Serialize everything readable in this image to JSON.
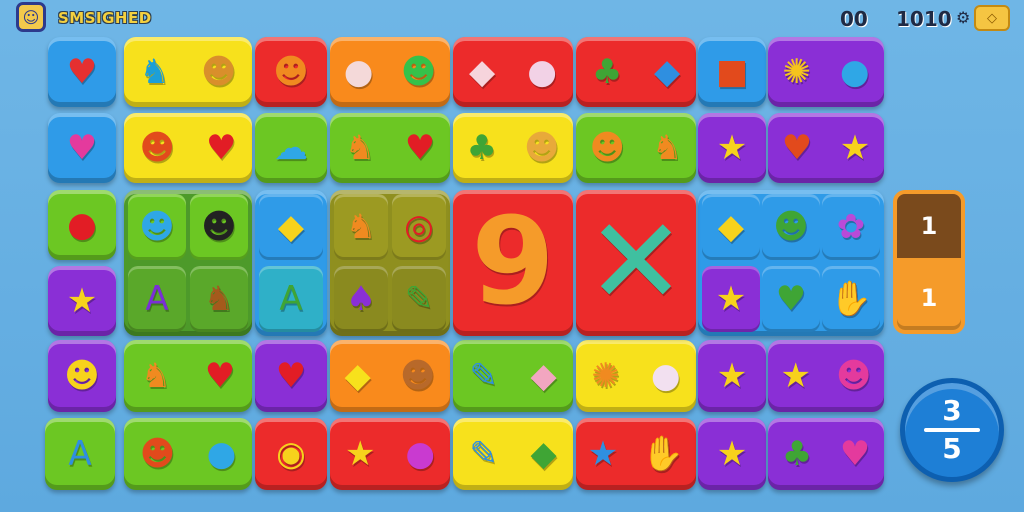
{
  "hud": {
    "title": "SMSIGHED",
    "avatar_icon": "robot-face-icon",
    "avatar_glyph": "☺",
    "counter_left": "00",
    "counter_right": "1010",
    "gear_icon": "gear-icon",
    "gear_glyph": "⚙",
    "coin_icon": "coin-icon",
    "coin_glyph": "◇"
  },
  "colors": {
    "blue": "#2f9be8",
    "yellow": "#f7e11c",
    "red": "#ec2b2b",
    "orange": "#f98a1c",
    "green": "#6cc723",
    "purple": "#8a2fd6",
    "olive": "#8f8f1f"
  },
  "tiles": [
    {
      "name": "tile-strawberry",
      "color": "blue",
      "icons": [
        {
          "name": "strawberry-icon",
          "glyph": "♥",
          "tint": "#e53030"
        }
      ]
    },
    {
      "name": "tile-animals",
      "color": "yellow",
      "icons": [
        {
          "name": "llama-icon",
          "glyph": "♞",
          "tint": "#1c9fd8"
        },
        {
          "name": "lion-face-icon",
          "glyph": "☻",
          "tint": "#d98f2b"
        }
      ]
    },
    {
      "name": "tile-lion",
      "color": "red",
      "icons": [
        {
          "name": "lion-face-icon",
          "glyph": "☻",
          "tint": "#f08a20"
        }
      ]
    },
    {
      "name": "tile-mouse-cat",
      "color": "orange",
      "icons": [
        {
          "name": "mouse-icon",
          "glyph": "●",
          "tint": "#f4d9d9"
        },
        {
          "name": "cat-face-icon",
          "glyph": "☻",
          "tint": "#35c24a"
        }
      ]
    },
    {
      "name": "tile-fish-bunny",
      "color": "red",
      "icons": [
        {
          "name": "fish-icon",
          "glyph": "◆",
          "tint": "#f6d4dc"
        },
        {
          "name": "bunny-icon",
          "glyph": "●",
          "tint": "#f2d2e6"
        }
      ]
    },
    {
      "name": "tile-leaf-feather",
      "color": "red",
      "icons": [
        {
          "name": "leaf-icon",
          "glyph": "♣",
          "tint": "#3fa535"
        },
        {
          "name": "feather-icon",
          "glyph": "◆",
          "tint": "#2f8fe0"
        }
      ]
    },
    {
      "name": "tile-box",
      "color": "blue",
      "icons": [
        {
          "name": "box-icon",
          "glyph": "■",
          "tint": "#e24a1c"
        }
      ]
    },
    {
      "name": "tile-sun-drop",
      "color": "purple",
      "icons": [
        {
          "name": "sun-icon",
          "glyph": "✺",
          "tint": "#f5c41d"
        },
        {
          "name": "droplet-icon",
          "glyph": "●",
          "tint": "#2fa7e6"
        }
      ]
    },
    {
      "name": "tile-chili",
      "color": "blue",
      "icons": [
        {
          "name": "chili-icon",
          "glyph": "♥",
          "tint": "#e43a9d"
        }
      ]
    },
    {
      "name": "tile-lion-heart",
      "color": "yellow",
      "icons": [
        {
          "name": "lion-face-icon",
          "glyph": "☻",
          "tint": "#e24a1c"
        },
        {
          "name": "heart-icon",
          "glyph": "♥",
          "tint": "#e21d25"
        }
      ]
    },
    {
      "name": "tile-cloud",
      "color": "green",
      "icons": [
        {
          "name": "cloud-icon",
          "glyph": "☁",
          "tint": "#2fa7e6"
        }
      ]
    },
    {
      "name": "tile-squirrel-heart",
      "color": "green",
      "icons": [
        {
          "name": "squirrel-icon",
          "glyph": "♞",
          "tint": "#f08a20"
        },
        {
          "name": "heart-icon",
          "glyph": "♥",
          "tint": "#e21d25"
        }
      ]
    },
    {
      "name": "tile-plant-cat",
      "color": "yellow",
      "icons": [
        {
          "name": "plant-icon",
          "glyph": "♣",
          "tint": "#3fa535"
        },
        {
          "name": "cat-face-icon",
          "glyph": "☻",
          "tint": "#e8a93a"
        }
      ]
    },
    {
      "name": "tile-lion-fox",
      "color": "green",
      "icons": [
        {
          "name": "lion-face-icon",
          "glyph": "☻",
          "tint": "#f08a20"
        },
        {
          "name": "fox-icon",
          "glyph": "♞",
          "tint": "#f08a20"
        }
      ]
    },
    {
      "name": "tile-star-purple-1",
      "color": "purple",
      "icons": [
        {
          "name": "star-icon",
          "glyph": "★",
          "tint": "#f7d21c"
        }
      ]
    },
    {
      "name": "tile-carrot-star",
      "color": "purple",
      "icons": [
        {
          "name": "carrot-icon",
          "glyph": "♥",
          "tint": "#e24a1c"
        },
        {
          "name": "star-icon",
          "glyph": "★",
          "tint": "#f7d21c"
        }
      ]
    },
    {
      "name": "tile-balloon",
      "color": "green",
      "icons": [
        {
          "name": "balloon-icon",
          "glyph": "●",
          "tint": "#e21d25"
        }
      ]
    },
    {
      "name": "tile-star-purple-2",
      "color": "purple",
      "icons": [
        {
          "name": "star-icon",
          "glyph": "★",
          "tint": "#f7d21c"
        }
      ]
    },
    {
      "name": "tile-heart-purple",
      "color": "purple",
      "icons": [
        {
          "name": "heart-icon",
          "glyph": "♥",
          "tint": "#e21d25"
        }
      ]
    },
    {
      "name": "tile-duck-cat",
      "color": "orange",
      "icons": [
        {
          "name": "duck-icon",
          "glyph": "◆",
          "tint": "#f7e11c"
        },
        {
          "name": "cat-face-icon",
          "glyph": "☻",
          "tint": "#b8692a"
        }
      ]
    },
    {
      "name": "tile-pencil-fish",
      "color": "green",
      "icons": [
        {
          "name": "pencil-icon",
          "glyph": "✎",
          "tint": "#2f8fe0"
        },
        {
          "name": "fish-icon",
          "glyph": "◆",
          "tint": "#f2a6c0"
        }
      ]
    },
    {
      "name": "tile-lion-ghost",
      "color": "yellow",
      "icons": [
        {
          "name": "lion-face-icon",
          "glyph": "✺",
          "tint": "#f08a20"
        },
        {
          "name": "ghost-icon",
          "glyph": "●",
          "tint": "#f2e0f0"
        }
      ]
    },
    {
      "name": "tile-star-purple-3",
      "color": "purple",
      "icons": [
        {
          "name": "star-icon",
          "glyph": "★",
          "tint": "#f7d21c"
        }
      ]
    },
    {
      "name": "tile-star-smile",
      "color": "purple",
      "icons": [
        {
          "name": "star-icon",
          "glyph": "★",
          "tint": "#f7d21c"
        },
        {
          "name": "smiley-icon",
          "glyph": "☻",
          "tint": "#e43a9d"
        }
      ]
    },
    {
      "name": "tile-bear",
      "color": "purple",
      "icons": [
        {
          "name": "bear-face-icon",
          "glyph": "☻",
          "tint": "#f7d21c"
        }
      ]
    },
    {
      "name": "tile-fox-bird",
      "color": "green",
      "icons": [
        {
          "name": "fox-icon",
          "glyph": "♞",
          "tint": "#f08a20"
        },
        {
          "name": "bird-icon",
          "glyph": "♥",
          "tint": "#e21d25"
        }
      ]
    },
    {
      "name": "tile-letter-a",
      "color": "green",
      "icons": [
        {
          "name": "letter-a-icon",
          "glyph": "A",
          "tint": "#2f8fe0"
        }
      ]
    },
    {
      "name": "tile-cat-drop",
      "color": "green",
      "icons": [
        {
          "name": "cat-face-icon",
          "glyph": "☻",
          "tint": "#e24a1c"
        },
        {
          "name": "droplet-icon",
          "glyph": "●",
          "tint": "#2fa7e6"
        }
      ]
    },
    {
      "name": "tile-coin",
      "color": "red",
      "icons": [
        {
          "name": "coin-icon",
          "glyph": "◉",
          "tint": "#f7d21c"
        }
      ]
    },
    {
      "name": "tile-star-plum",
      "color": "red",
      "icons": [
        {
          "name": "star-icon",
          "glyph": "★",
          "tint": "#f7d21c"
        },
        {
          "name": "plum-icon",
          "glyph": "●",
          "tint": "#c93ad0"
        }
      ]
    },
    {
      "name": "tile-pen-fish",
      "color": "yellow",
      "icons": [
        {
          "name": "pen-icon",
          "glyph": "✎",
          "tint": "#2f8fe0"
        },
        {
          "name": "fish-icon",
          "glyph": "◆",
          "tint": "#3fa535"
        }
      ]
    },
    {
      "name": "tile-star-hand",
      "color": "red",
      "icons": [
        {
          "name": "star-icon",
          "glyph": "★",
          "tint": "#2f8fe0"
        },
        {
          "name": "hand-icon",
          "glyph": "✋",
          "tint": "#f7d21c"
        }
      ]
    },
    {
      "name": "tile-star-purple-4",
      "color": "purple",
      "icons": [
        {
          "name": "star-icon",
          "glyph": "★",
          "tint": "#f7d21c"
        }
      ]
    },
    {
      "name": "tile-leaf-heart",
      "color": "purple",
      "icons": [
        {
          "name": "leaf-icon",
          "glyph": "♣",
          "tint": "#3fa535"
        },
        {
          "name": "heart-icon",
          "glyph": "♥",
          "tint": "#e43a9d"
        }
      ]
    },
    {
      "name": "tile-nine",
      "color": "red",
      "icons": [
        {
          "name": "number-nine-icon",
          "glyph": "9",
          "tint": "#f59b2a",
          "big": true
        }
      ]
    },
    {
      "name": "tile-pinwheel",
      "color": "red",
      "icons": [
        {
          "name": "pinwheel-icon",
          "glyph": "✕",
          "tint": "#3fc0a0",
          "big": true
        }
      ]
    }
  ],
  "block_green": {
    "icons": [
      {
        "name": "kitten-icon",
        "glyph": "☻",
        "tint": "#2fa7e6"
      },
      {
        "name": "cat-face-icon",
        "glyph": "☻",
        "tint": "#222222"
      },
      {
        "name": "letter-a-icon",
        "glyph": "A",
        "tint": "#7a2fd6"
      },
      {
        "name": "squirrel-icon",
        "glyph": "♞",
        "tint": "#a45a1c"
      }
    ]
  },
  "block_blue": {
    "icons": [
      {
        "name": "bird-icon",
        "glyph": "◆",
        "tint": "#f7d21c"
      },
      {
        "name": "letter-a-icon",
        "glyph": "A",
        "tint": "#3fa535"
      }
    ]
  },
  "block_olive": {
    "icons": [
      {
        "name": "squirrel-icon",
        "glyph": "♞",
        "tint": "#f08a20"
      },
      {
        "name": "target-icon",
        "glyph": "◎",
        "tint": "#e21d25"
      },
      {
        "name": "tulip-icon",
        "glyph": "♠",
        "tint": "#8a2fd6"
      },
      {
        "name": "match-icon",
        "glyph": "✎",
        "tint": "#3fa535"
      }
    ]
  },
  "block_right": {
    "icons": [
      {
        "name": "bird-icon",
        "glyph": "◆",
        "tint": "#f7d21c"
      },
      {
        "name": "monster-icon",
        "glyph": "☻",
        "tint": "#3fa535"
      },
      {
        "name": "flower-icon",
        "glyph": "✿",
        "tint": "#b84ad8"
      },
      {
        "name": "star-icon",
        "glyph": "★",
        "tint": "#f7d21c"
      },
      {
        "name": "bird-icon",
        "glyph": "♥",
        "tint": "#3fa535"
      },
      {
        "name": "hand-icon",
        "glyph": "✋",
        "tint": "#f7d21c"
      }
    ]
  },
  "side_counter": {
    "top": "1",
    "bottom": "1"
  },
  "fraction": {
    "numerator": "3",
    "denominator": "5",
    "arrow_icon": "arrow-left-icon"
  }
}
